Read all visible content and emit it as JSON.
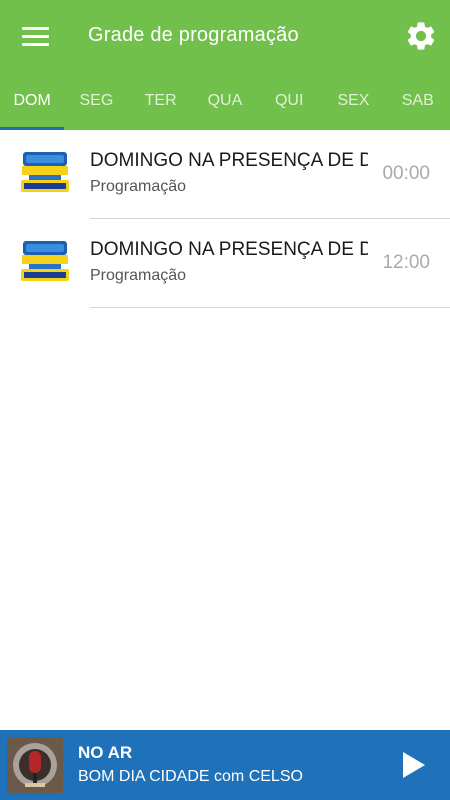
{
  "header": {
    "title": "Grade de programação",
    "menu_icon": "hamburger-menu-icon",
    "settings_icon": "gear-icon",
    "bg_color": "#72c04c"
  },
  "tabs": [
    {
      "label": "DOM",
      "active": true
    },
    {
      "label": "SEG",
      "active": false
    },
    {
      "label": "TER",
      "active": false
    },
    {
      "label": "QUA",
      "active": false
    },
    {
      "label": "QUI",
      "active": false
    },
    {
      "label": "SEX",
      "active": false
    },
    {
      "label": "SAB",
      "active": false
    }
  ],
  "schedule": [
    {
      "title": "DOMINGO NA PRESENÇA DE DEUS",
      "subtitle": "Programação",
      "time": "00:00",
      "logo": "radio-cidade-100-jesus-logo"
    },
    {
      "title": "DOMINGO NA PRESENÇA DE DEUS",
      "subtitle": "Programação",
      "time": "12:00",
      "logo": "radio-cidade-100-jesus-logo"
    }
  ],
  "player": {
    "label": "NO AR",
    "now_playing": "BOM DIA CIDADE com CELSO",
    "play_icon": "play-icon",
    "bg_color": "#1f72ba"
  }
}
